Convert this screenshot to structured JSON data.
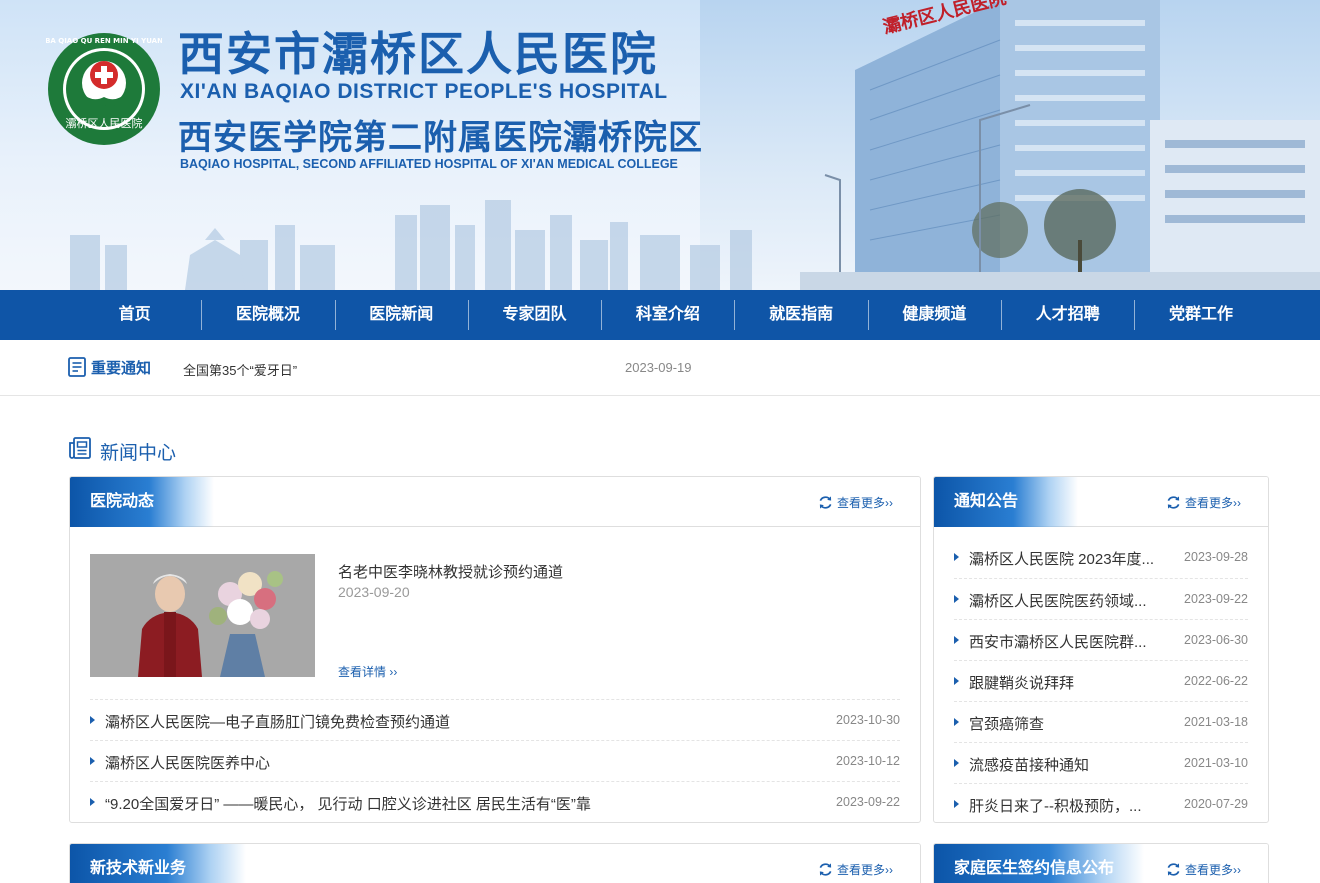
{
  "banner": {
    "title_cn": "西安市灞桥区人民医院",
    "title_en": "XI'AN BAQIAO DISTRICT PEOPLE'S HOSPITAL",
    "subtitle_cn": "西安医学院第二附属医院灞桥院区",
    "subtitle_en": "BAQIAO HOSPITAL, SECOND AFFILIATED HOSPITAL OF XI'AN MEDICAL COLLEGE",
    "logo_ring_text": "BA QIAO QU REN MIN YI YUAN",
    "logo_inner_text": "灞桥区人民医院",
    "building_sign": "灞桥区人民医院",
    "accent_color": "#1b5fae",
    "logo_color": "#1e7a3a"
  },
  "nav": {
    "items": [
      "首页",
      "医院概况",
      "医院新闻",
      "专家团队",
      "科室介绍",
      "就医指南",
      "健康频道",
      "人才招聘",
      "党群工作"
    ]
  },
  "notice": {
    "label": "重要通知",
    "text": "全国第35个“爱牙日”",
    "date": "2023-09-19"
  },
  "news_center": {
    "title": "新闻中心"
  },
  "hospital_news": {
    "tab": "医院动态",
    "more": "查看更多››",
    "featured": {
      "title": "名老中医李晓林教授就诊预约通道",
      "date": "2023-09-20",
      "link": "查看详情 ››"
    },
    "items": [
      {
        "title": "灞桥区人民医院—电子直肠肛门镜免费检查预约通道",
        "date": "2023-10-30"
      },
      {
        "title": "灞桥区人民医院医养中心",
        "date": "2023-10-12"
      },
      {
        "title": "“9.20全国爱牙日” ——暖民心， 见行动 口腔义诊进社区 居民生活有“医”靠",
        "date": "2023-09-22"
      }
    ]
  },
  "announcements": {
    "tab": "通知公告",
    "more": "查看更多››",
    "items": [
      {
        "title": "灞桥区人民医院 2023年度...",
        "date": "2023-09-28"
      },
      {
        "title": "灞桥区人民医院医药领域...",
        "date": "2023-09-22"
      },
      {
        "title": "西安市灞桥区人民医院群...",
        "date": "2023-06-30"
      },
      {
        "title": "跟腱鞘炎说拜拜",
        "date": "2022-06-22"
      },
      {
        "title": "宫颈癌筛查",
        "date": "2021-03-18"
      },
      {
        "title": "流感疫苗接种通知",
        "date": "2021-03-10"
      },
      {
        "title": "肝炎日来了--积极预防，...",
        "date": "2020-07-29"
      }
    ]
  },
  "new_tech": {
    "tab": "新技术新业务",
    "more": "查看更多››"
  },
  "family_doctor": {
    "tab": "家庭医生签约信息公布",
    "more": "查看更多››"
  }
}
